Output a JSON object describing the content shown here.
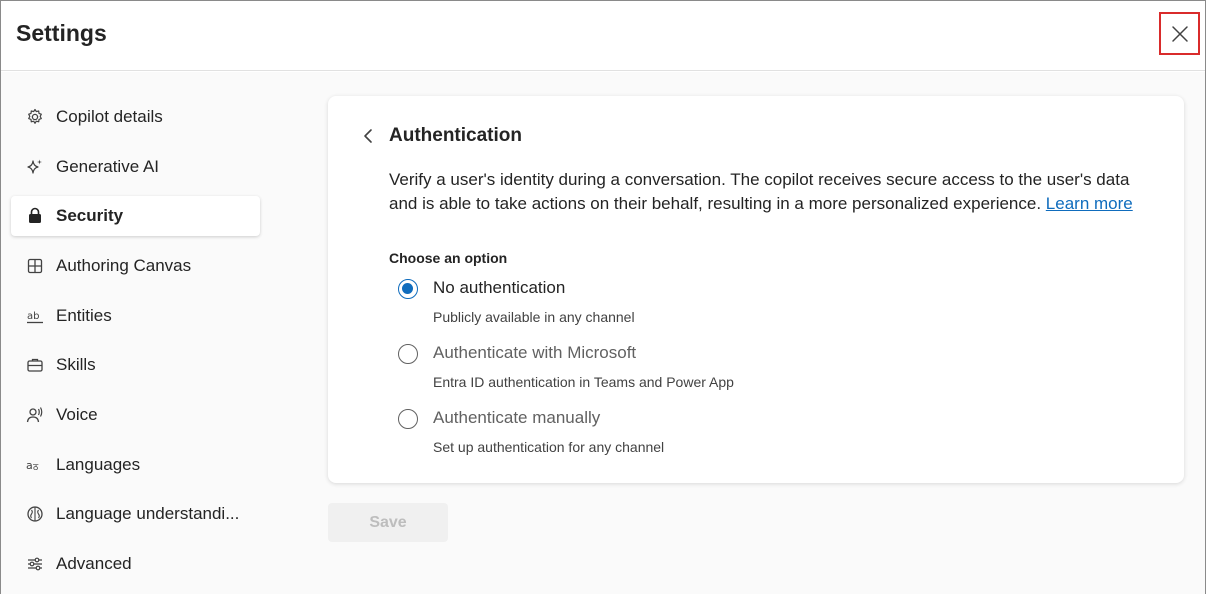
{
  "header": {
    "title": "Settings",
    "close_icon": "close-icon"
  },
  "sidebar": {
    "items": [
      {
        "label": "Copilot details",
        "icon": "gear-icon"
      },
      {
        "label": "Generative AI",
        "icon": "sparkle-icon"
      },
      {
        "label": "Security",
        "icon": "lock-icon",
        "active": true
      },
      {
        "label": "Authoring Canvas",
        "icon": "grid-icon"
      },
      {
        "label": "Entities",
        "icon": "text-ab-icon"
      },
      {
        "label": "Skills",
        "icon": "briefcase-icon"
      },
      {
        "label": "Voice",
        "icon": "person-voice-icon"
      },
      {
        "label": "Languages",
        "icon": "translate-icon"
      },
      {
        "label": "Language understandi...",
        "icon": "brain-icon"
      },
      {
        "label": "Advanced",
        "icon": "sliders-icon"
      }
    ]
  },
  "card": {
    "title": "Authentication",
    "description": "Verify a user's identity during a conversation. The copilot receives secure access to the user's data and is able to take actions on their behalf, resulting in a more personalized experience.",
    "learn_more": "Learn more",
    "option_heading": "Choose an option",
    "options": [
      {
        "label": "No authentication",
        "sublabel": "Publicly available in any channel",
        "selected": true
      },
      {
        "label": "Authenticate with Microsoft",
        "sublabel": "Entra ID authentication in Teams and Power App",
        "selected": false
      },
      {
        "label": "Authenticate manually",
        "sublabel": "Set up authentication for any channel",
        "selected": false
      }
    ]
  },
  "footer": {
    "save_label": "Save",
    "save_disabled": true
  },
  "colors": {
    "accent": "#0f6cbd",
    "highlight_border": "#d92b2b"
  }
}
